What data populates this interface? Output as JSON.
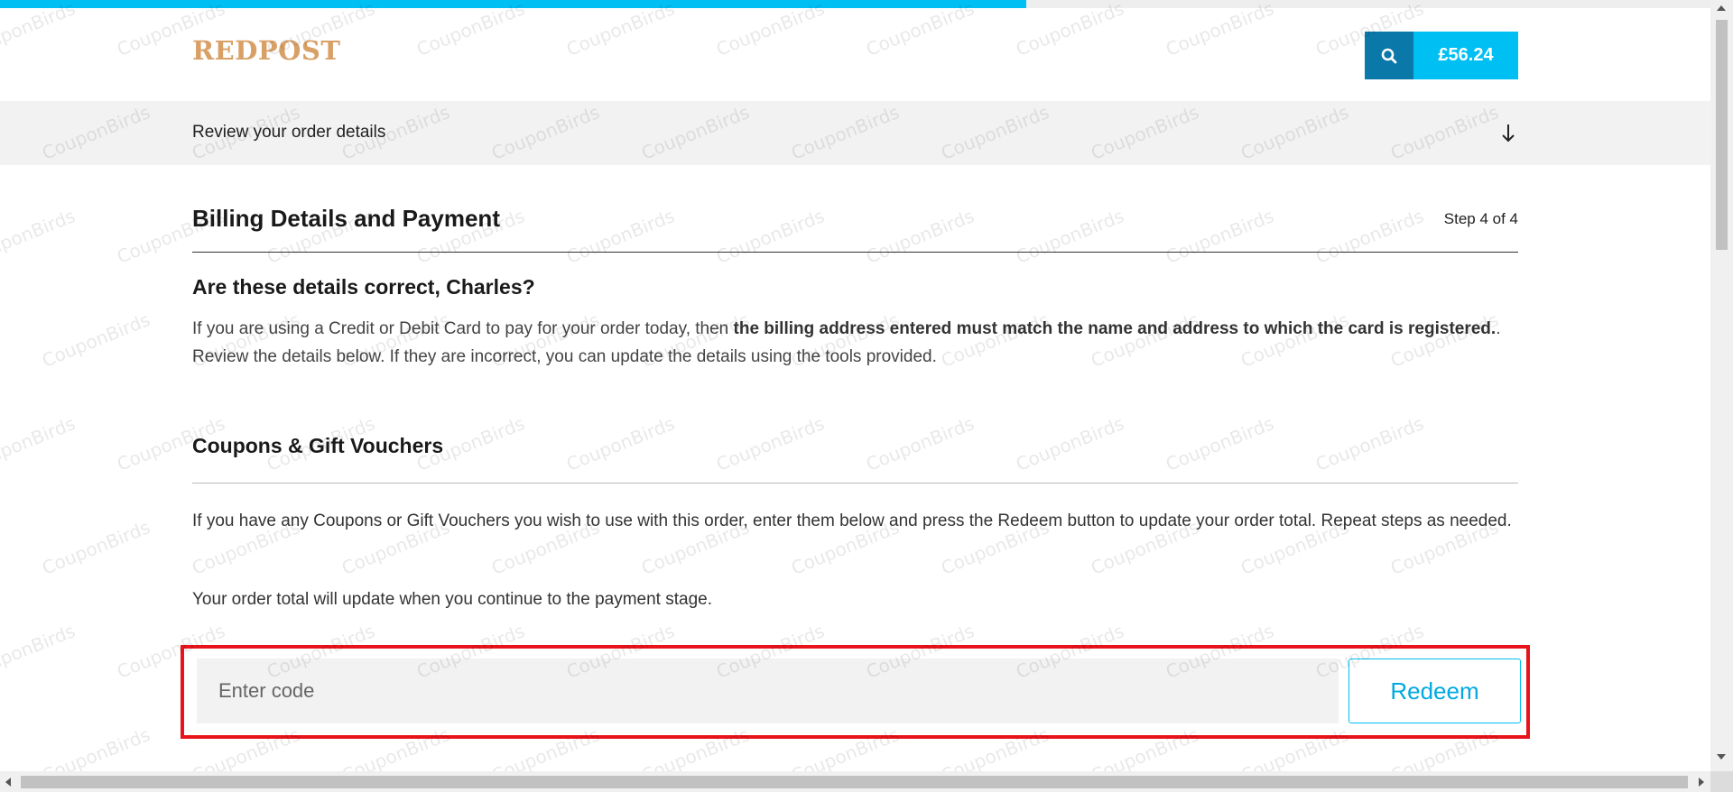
{
  "progress": {
    "fraction": 0.6
  },
  "header": {
    "logo_text": "REDPOST",
    "search_icon": "search-icon",
    "cart_total": "£56.24"
  },
  "review_bar": {
    "label": "Review your order details",
    "icon": "arrow-down-icon"
  },
  "billing": {
    "title": "Billing Details and Payment",
    "step": "Step 4 of 4",
    "question": "Are these details correct, Charles?",
    "para_prefix": "If you are using a Credit or Debit Card to pay for your order today, then ",
    "para_bold": "the billing address entered must match the name and address to which the card is registered.",
    "para_suffix": ". Review the details below. If they are incorrect, you can update the details using the tools provided."
  },
  "coupons": {
    "title": "Coupons & Gift Vouchers",
    "para1": "If you have any Coupons or Gift Vouchers you wish to use with this order, enter them below and press the Redeem button to update your order total. Repeat steps as needed.",
    "para2": "Your order total will update when you continue to the payment stage.",
    "input_placeholder": "Enter code",
    "input_value": "",
    "redeem_label": "Redeem"
  },
  "watermark_text": "CouponBirds",
  "colors": {
    "accent": "#00bff3",
    "search_bg": "#0a78a8",
    "highlight_border": "#e8141b",
    "logo": "#d9a066"
  }
}
